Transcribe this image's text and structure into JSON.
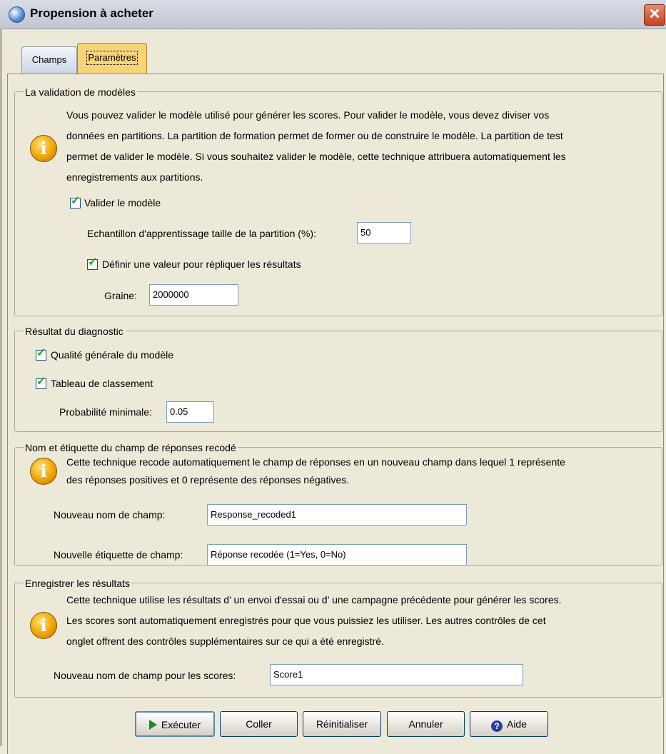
{
  "window": {
    "title": "Propension à acheter",
    "close_symbol": "✕"
  },
  "tabs": [
    {
      "label": "Champs",
      "selected": false
    },
    {
      "label": "Paramètres",
      "selected": true
    }
  ],
  "validation": {
    "legend": "La validation de modèles",
    "info": [
      "Vous pouvez valider le modèle utilisé pour générer les scores. Pour valider le modèle, vous devez diviser vos",
      "données en partitions. La partition de formation permet de former ou de construire le modèle. La partition de test",
      "permet de valider le modèle. Si vous souhaitez valider le modèle, cette technique attribuera automatiquement les",
      "enregistrements aux partitions."
    ],
    "validate_label": "Valider le modèle",
    "validate_checked": true,
    "sample_size_label": "Echantillon d'apprentissage taille de la partition (%):",
    "sample_size_value": "50",
    "seed_check_label": "Définir une valeur pour répliquer les résultats",
    "seed_checked": true,
    "seed_label": "Graine:",
    "seed_value": "2000000"
  },
  "diagnostic": {
    "legend": "Résultat du diagnostic",
    "quality_label": "Qualité générale du modèle",
    "quality_checked": true,
    "classification_label": "Tableau de classement",
    "classification_checked": true,
    "min_prob_label": "Probabilité minimale:",
    "min_prob_value": "0.05"
  },
  "recoded": {
    "legend": "Nom et étiquette du champ de réponses recodé",
    "info": [
      "Cette technique recode automatiquement le champ de réponses en un nouveau champ dans lequel 1 représente",
      "des réponses positives et 0 représente des réponses négatives."
    ],
    "field_name_label": "Nouveau nom de champ:",
    "field_name_value": "Response_recoded1",
    "field_label_label": "Nouvelle étiquette de champ:",
    "field_label_value": "Réponse recodée (1=Yes, 0=No)"
  },
  "save": {
    "legend": "Enregistrer les résultats",
    "info": [
      "Cette technique utilise les résultats d’ un envoi d'essai ou d’ une campagne précédente pour générer les scores.",
      "Les scores sont automatiquement enregistrés pour que vous puissiez les utiliser. Les autres contrôles de cet",
      "onglet offrent des contrôles supplémentaires sur ce qui a été enregistré."
    ],
    "score_name_label": "Nouveau nom de champ pour les scores:",
    "score_name_value": "Score1"
  },
  "buttons": {
    "run": "Exécuter",
    "paste": "Coller",
    "reset": "Réinitialiser",
    "cancel": "Annuler",
    "help": "Aide"
  },
  "icons": {
    "info": "info-icon",
    "run": "play-icon",
    "help": "help-question-icon",
    "window": "globe-icon"
  },
  "colors": {
    "dialog_bg": "#ece9d8",
    "selected_tab": "#f7d37a",
    "check_mark": "#21a121",
    "close_button": "#c4431f"
  }
}
